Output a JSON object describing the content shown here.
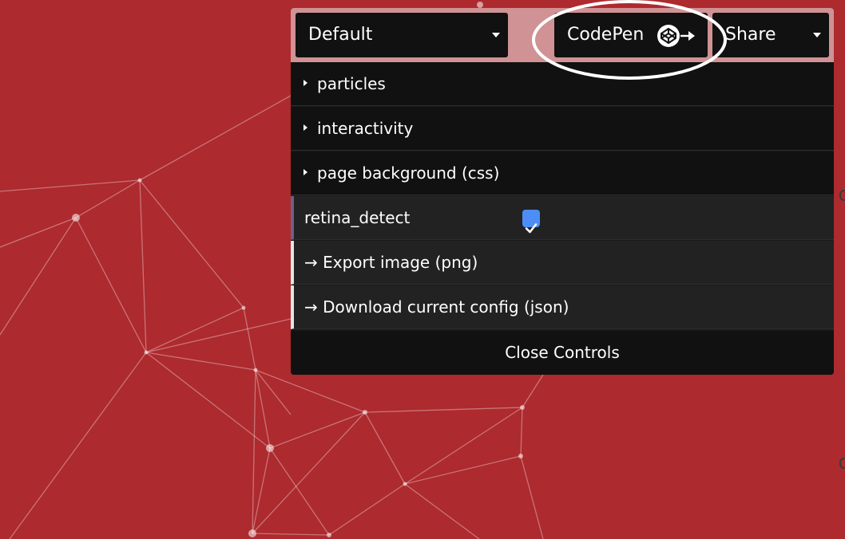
{
  "background": {
    "color": "#ad2a2e",
    "particle_color": "#ffffff"
  },
  "panel": {
    "preset": {
      "value": "Default"
    },
    "codepen": {
      "label": "CodePen",
      "icon": "codepen-logo-icon"
    },
    "share": {
      "value": "Share"
    },
    "folders": [
      {
        "label": "particles"
      },
      {
        "label": "interactivity"
      },
      {
        "label": "page background (css)"
      }
    ],
    "retina_detect": {
      "label": "retina_detect",
      "checked": true,
      "check_color": "#4c8ef5"
    },
    "actions": [
      {
        "label": "→ Export image (png)"
      },
      {
        "label": "→ Download current config (json)"
      }
    ],
    "close_label": "Close Controls"
  }
}
